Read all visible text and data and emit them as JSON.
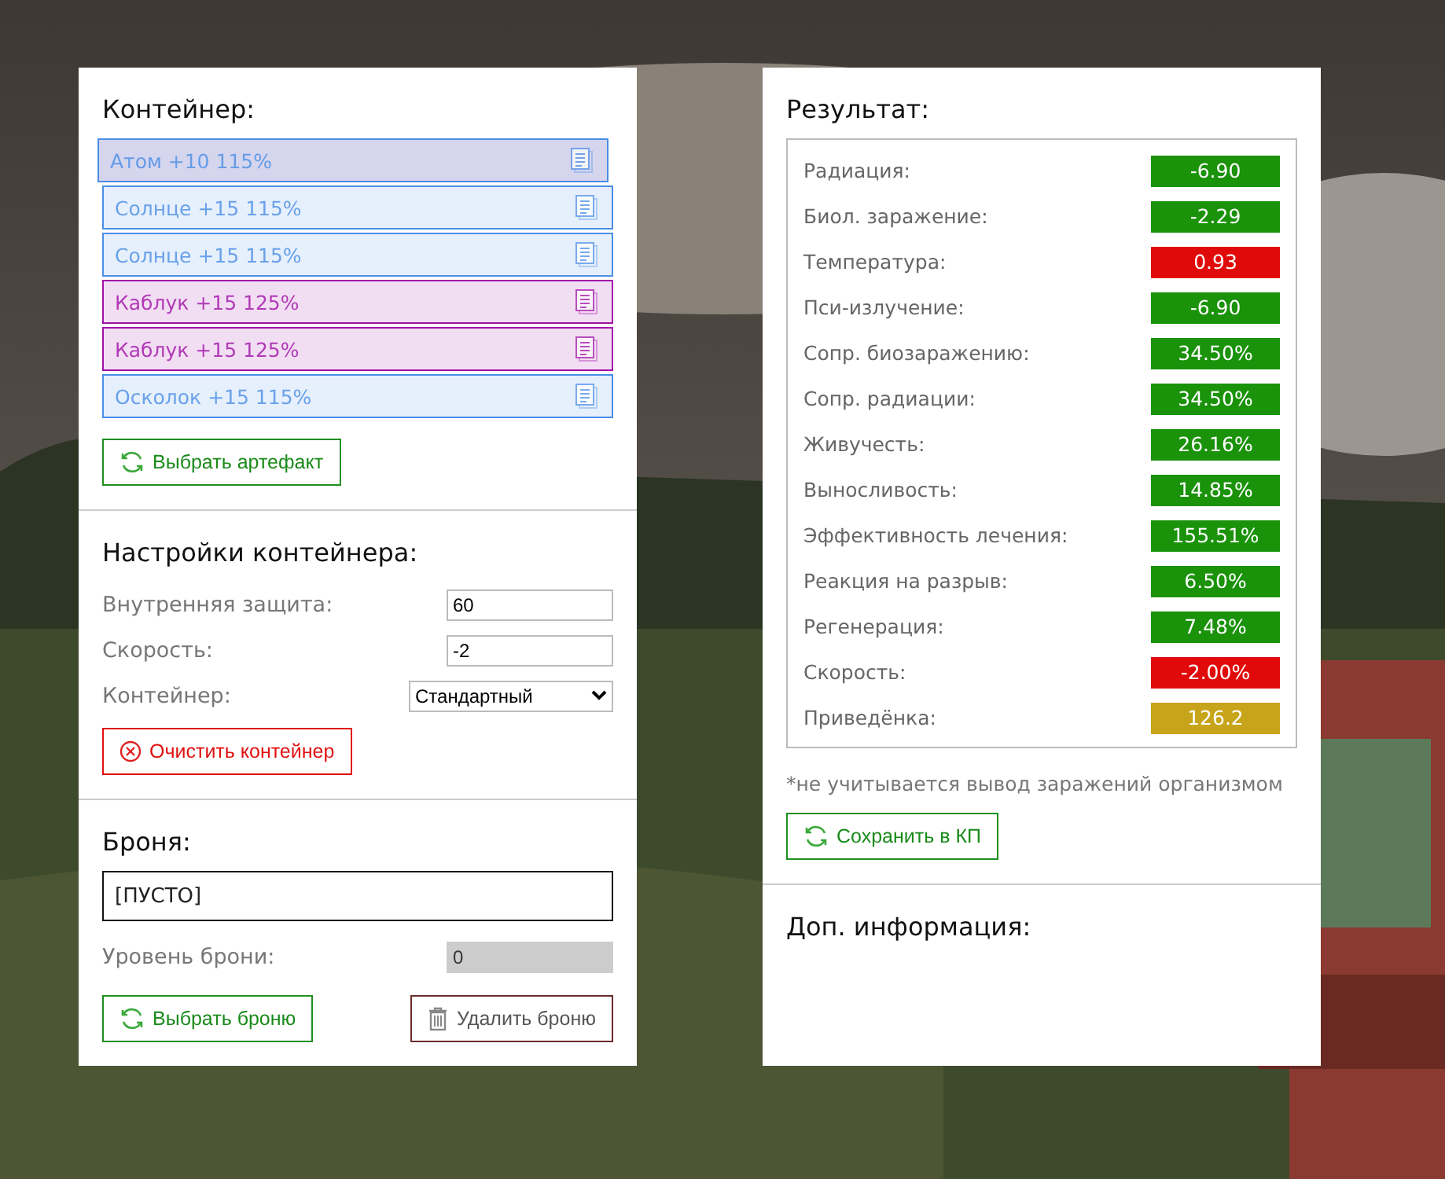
{
  "container": {
    "title": "Контейнер:",
    "items": [
      {
        "label": "Атом +10 115%",
        "color": "#4a8ee6",
        "selected": true
      },
      {
        "label": "Солнце +15 115%",
        "color": "#4a8ee6",
        "selected": false
      },
      {
        "label": "Солнце +15 115%",
        "color": "#4a8ee6",
        "selected": false
      },
      {
        "label": "Каблук +15 125%",
        "color": "#a010a8",
        "selected": false
      },
      {
        "label": "Каблук +15 125%",
        "color": "#a010a8",
        "selected": false
      },
      {
        "label": "Осколок +15 115%",
        "color": "#4a8ee6",
        "selected": false
      }
    ],
    "select_button": "Выбрать артефакт"
  },
  "settings": {
    "title": "Настройки контейнера:",
    "fields": [
      {
        "kind": "input",
        "label": "Внутренняя защита:",
        "value": "60"
      },
      {
        "kind": "input",
        "label": "Скорость:",
        "value": "-2"
      },
      {
        "kind": "select",
        "label": "Контейнер:",
        "value": "Стандартный"
      }
    ],
    "clear_button": "Очистить контейнер"
  },
  "armor": {
    "title": "Броня:",
    "name_value": "[ПУСТО]",
    "level_label": "Уровень брони:",
    "level_value": "0",
    "level_disabled": true,
    "select_button": "Выбрать броню",
    "delete_button": "Удалить броню"
  },
  "result": {
    "title": "Результат:",
    "stats": [
      {
        "label": "Радиация:",
        "value": "-6.90",
        "color": "#1a920a"
      },
      {
        "label": "Биол. заражение:",
        "value": "-2.29",
        "color": "#1a920a"
      },
      {
        "label": "Температура:",
        "value": "0.93",
        "color": "#e00a0a"
      },
      {
        "label": "Пси-излучение:",
        "value": "-6.90",
        "color": "#1a920a"
      },
      {
        "label": "Сопр. биозаражению:",
        "value": "34.50%",
        "color": "#1a920a"
      },
      {
        "label": "Сопр. радиации:",
        "value": "34.50%",
        "color": "#1a920a"
      },
      {
        "label": "Живучесть:",
        "value": "26.16%",
        "color": "#1a920a"
      },
      {
        "label": "Выносливость:",
        "value": "14.85%",
        "color": "#1a920a"
      },
      {
        "label": "Эффективность лечения:",
        "value": "155.51%",
        "color": "#1a920a"
      },
      {
        "label": "Реакция на разрыв:",
        "value": "6.50%",
        "color": "#1a920a"
      },
      {
        "label": "Регенерация:",
        "value": "7.48%",
        "color": "#1a920a"
      },
      {
        "label": "Скорость:",
        "value": "-2.00%",
        "color": "#e00a0a"
      },
      {
        "label": "Приведёнка:",
        "value": "126.2",
        "color": "#c8a41a"
      }
    ],
    "note": "*не учитывается вывод заражений организмом",
    "save_button": "Сохранить в КП"
  },
  "extra": {
    "title": "Доп. информация:"
  }
}
